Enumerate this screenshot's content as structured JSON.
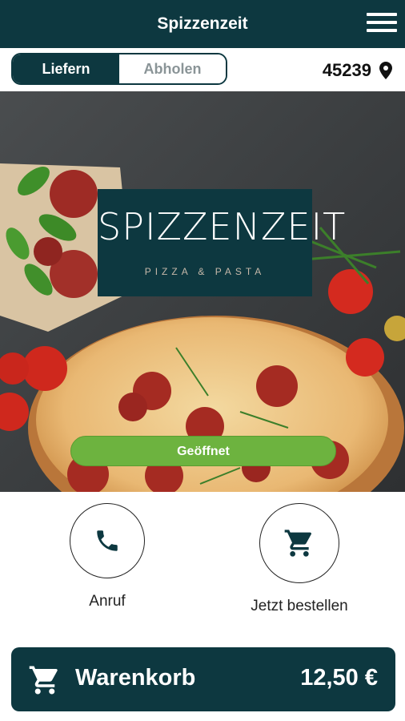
{
  "appbar": {
    "title": "Spizzenzeit",
    "menu_icon": "hamburger-menu-icon"
  },
  "delivery_toggle": {
    "options": [
      "Liefern",
      "Abholen"
    ],
    "selected": "Liefern"
  },
  "location": {
    "zip": "45239",
    "icon": "location-pin-icon"
  },
  "hero": {
    "logo_title": "SPIZZENZEIT",
    "logo_subtitle": "PIZZA & PASTA",
    "status_label": "Geöffnet"
  },
  "actions": {
    "call": {
      "label": "Anruf",
      "icon": "phone-icon"
    },
    "order": {
      "label": "Jetzt bestellen",
      "icon": "cart-icon"
    }
  },
  "cart": {
    "label": "Warenkorb",
    "total": "12,50 €",
    "icon": "cart-icon"
  },
  "colors": {
    "primary": "#0d3840",
    "open_green": "#6db33f",
    "inactive_text": "#8a9497"
  }
}
